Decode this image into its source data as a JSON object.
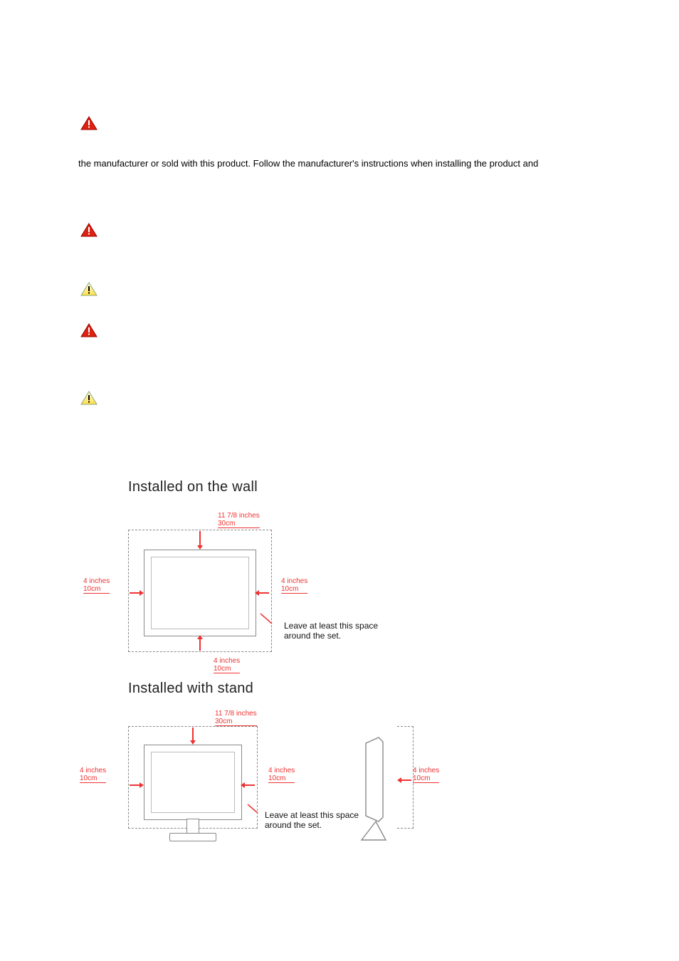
{
  "paragraphs": {
    "p1": "the manufacturer or sold with this product. Follow the manufacturer's instructions when installing the product and"
  },
  "diagram": {
    "heading_wall": "Installed on the wall",
    "heading_stand": "Installed with stand",
    "measure_top": "11 7/8 inches\n30cm",
    "measure_side": "4 inches\n10cm",
    "caption": "Leave at least this space\naround the set."
  },
  "icons": {
    "alt_red": "warning-triangle-red",
    "alt_yellow": "warning-triangle-yellow"
  }
}
